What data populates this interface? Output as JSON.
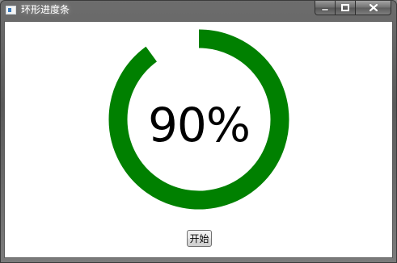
{
  "window": {
    "title": "环形进度条",
    "icon": "app-window-icon"
  },
  "caption": {
    "minimize_icon": "minimize-icon",
    "maximize_icon": "maximize-icon",
    "close_icon": "close-icon"
  },
  "progress": {
    "value_fraction": 0.9,
    "label": "90%",
    "color": "#008000",
    "track_color": "#ffffff"
  },
  "controls": {
    "start_label": "开始"
  }
}
